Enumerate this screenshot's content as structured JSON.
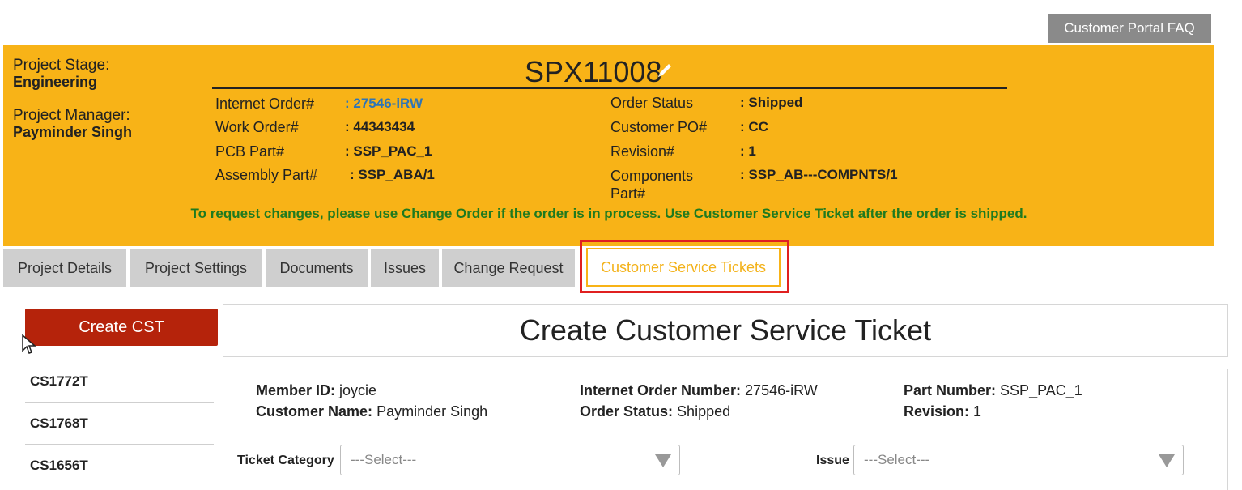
{
  "header": {
    "faq_button": "Customer Portal FAQ"
  },
  "project": {
    "stage_label": "Project Stage:",
    "stage_value": "Engineering",
    "manager_label": "Project Manager:",
    "manager_value": "Payminder Singh",
    "title": "SPX11008",
    "fields_left": [
      {
        "label": "Internet Order#",
        "value": ": 27546-iRW"
      },
      {
        "label": "Work Order#",
        "value": ": 44343434"
      },
      {
        "label": "PCB Part#",
        "value": ": SSP_PAC_1"
      },
      {
        "label": "Assembly Part#",
        "value": ": SSP_ABA/1"
      }
    ],
    "fields_right": [
      {
        "label": "Order Status",
        "value": ": Shipped"
      },
      {
        "label": "Customer PO#",
        "value": ": CC"
      },
      {
        "label": "Revision#",
        "value": ": 1"
      },
      {
        "label": "Components Part#",
        "value": ": SSP_AB---COMPNTS/1"
      }
    ],
    "notice": "To request changes, please use Change Order if the order is in process. Use Customer Service Ticket after the order is shipped."
  },
  "tabs": [
    "Project Details",
    "Project Settings",
    "Documents",
    "Issues",
    "Change Request",
    "Customer Service Tickets"
  ],
  "sidebar": {
    "create_button": "Create CST",
    "tickets": [
      "CS1772T",
      "CS1768T",
      "CS1656T"
    ]
  },
  "form": {
    "title": "Create Customer Service Ticket",
    "member_id_label": "Member ID:",
    "member_id_value": "joycie",
    "customer_name_label": "Customer Name:",
    "customer_name_value": "Payminder Singh",
    "internet_order_label": "Internet Order Number:",
    "internet_order_value": "27546-iRW",
    "order_status_label": "Order Status:",
    "order_status_value": "Shipped",
    "part_number_label": "Part Number:",
    "part_number_value": "SSP_PAC_1",
    "revision_label": "Revision:",
    "revision_value": "1",
    "ticket_category_label": "Ticket Category",
    "ticket_category_selected": "---Select---",
    "issue_label": "Issue",
    "issue_selected": "---Select---"
  },
  "colors": {
    "banner": "#f8b317",
    "notice_text": "#1f7a1f",
    "link": "#2e75b6",
    "create_button": "#b5230b",
    "active_tab_highlight": "#e02020"
  }
}
